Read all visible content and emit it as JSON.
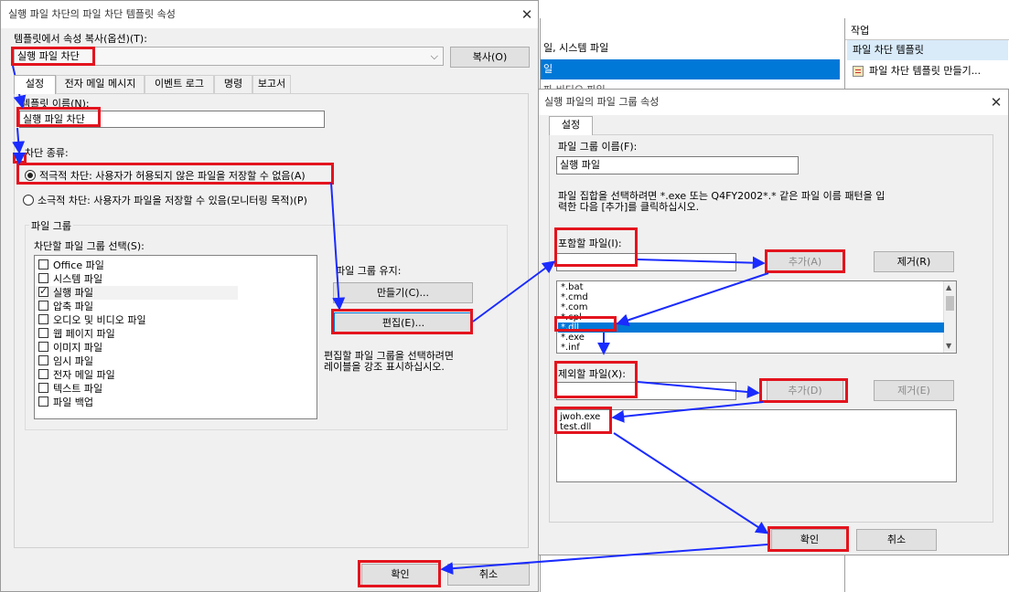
{
  "background_window": {
    "rows": [
      "일, 시스템 파일",
      "일",
      "파 비디오 파일"
    ],
    "actions_header": "작업",
    "actions_selected": "파일 차단 템플릿",
    "actions_item": "파일 차단 템플릿 만들기..."
  },
  "template_dialog": {
    "title": "실행 파일 차단의 파일 차단 템플릿 속성",
    "copy_label": "템플릿에서 속성 복사(옵션)(T):",
    "copy_select_value": "실행 파일 차단",
    "copy_button": "복사(O)",
    "tabs": [
      "설정",
      "전자 메일 메시지",
      "이벤트 로그",
      "명령",
      "보고서"
    ],
    "template_name_label": "템플릿 이름(N):",
    "template_name_value": "실행 파일 차단",
    "block_type_label": "차단 종류:",
    "active_radio": "적극적 차단: 사용자가 허용되지 않은 파일을 저장할 수 없음(A)",
    "passive_radio": "소극적 차단: 사용자가 파일을 저장할 수 있음(모니터링 목적)(P)",
    "file_group_legend": "파일 그룹",
    "file_group_select_label": "차단할 파일 그룹 선택(S):",
    "file_groups": [
      {
        "label": "Office 파일",
        "checked": false
      },
      {
        "label": "시스템 파일",
        "checked": false
      },
      {
        "label": "실행 파일",
        "checked": true
      },
      {
        "label": "압축 파일",
        "checked": false
      },
      {
        "label": "오디오 및 비디오 파일",
        "checked": false
      },
      {
        "label": "웹 페이지 파일",
        "checked": false
      },
      {
        "label": "이미지 파일",
        "checked": false
      },
      {
        "label": "임시 파일",
        "checked": false
      },
      {
        "label": "전자 메일 파일",
        "checked": false
      },
      {
        "label": "텍스트 파일",
        "checked": false
      },
      {
        "label": "파일 백업",
        "checked": false
      }
    ],
    "maintain_label": "파일 그룹 유지:",
    "create_button": "만들기(C)...",
    "edit_button": "편집(E)...",
    "edit_hint_line1": "편집할 파일 그룹을 선택하려면",
    "edit_hint_line2": "레이블을 강조 표시하십시오.",
    "ok_button": "확인",
    "cancel_button": "취소"
  },
  "group_dialog": {
    "title": "실행 파일의 파일 그룹 속성",
    "tab": "설정",
    "group_name_label": "파일 그룹 이름(F):",
    "group_name_value": "실행 파일",
    "instruction_line1": "파일 집합을 선택하려면 *.exe 또는 Q4FY2002*.* 같은 파일 이름 패턴을 입",
    "instruction_line2": "력한 다음 [추가]를 클릭하십시오.",
    "include_label": "포함할 파일(I):",
    "include_input_value": "",
    "add_button": "추가(A)",
    "remove_button": "제거(R)",
    "include_files": [
      "*.bat",
      "*.cmd",
      "*.com",
      "*.cpl",
      "*.dll",
      "*.exe",
      "*.inf"
    ],
    "include_selected_index": 4,
    "exclude_label": "제외할 파일(X):",
    "exclude_input_value": "",
    "add_button2": "추가(D)",
    "remove_button2": "제거(E)",
    "exclude_files": [
      "jwoh.exe",
      "test.dll"
    ],
    "ok_button": "확인",
    "cancel_button": "취소"
  },
  "colors": {
    "highlight_box": "#e3141e",
    "arrow": "#1a2bff",
    "selection": "#0078d7"
  }
}
